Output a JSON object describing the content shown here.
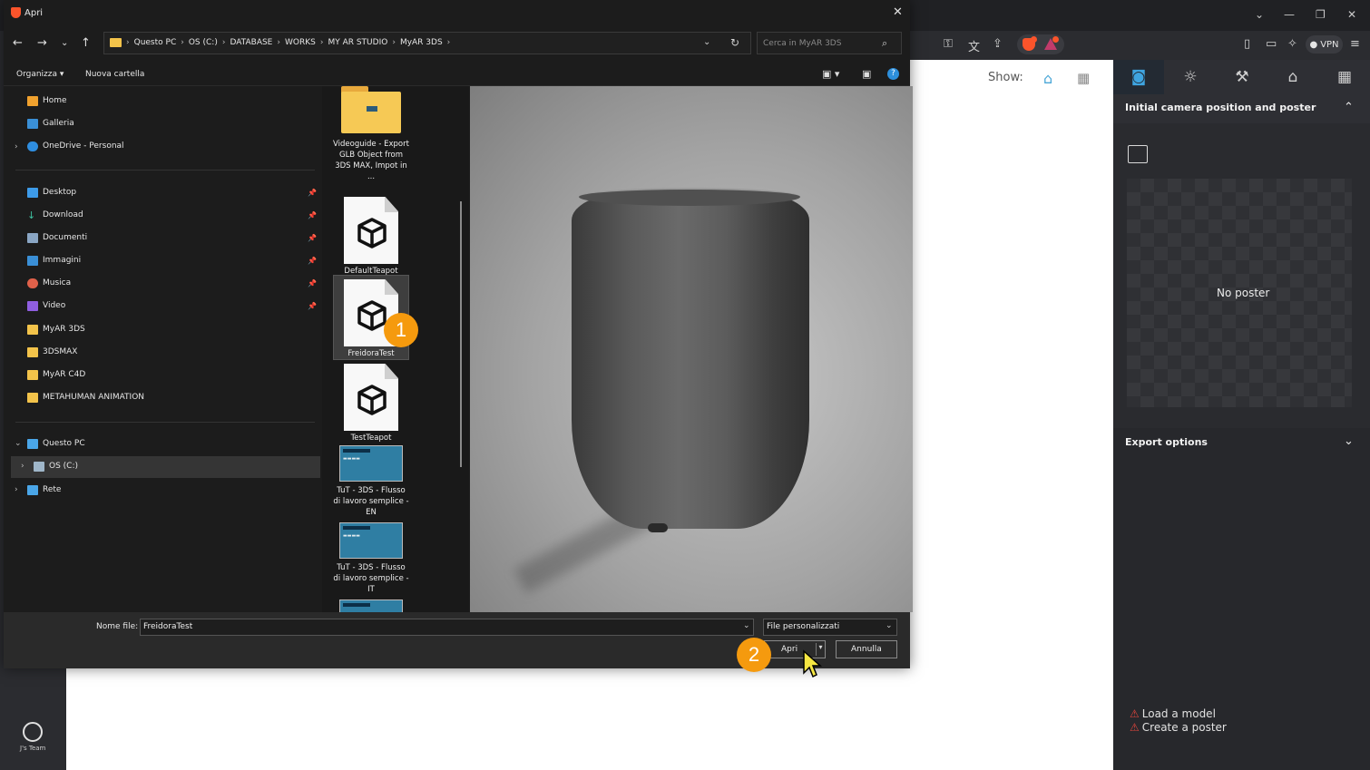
{
  "dialog": {
    "title": "Apri",
    "breadcrumb": [
      "Questo PC",
      "OS (C:)",
      "DATABASE",
      "WORKS",
      "MY AR STUDIO",
      "MyAR 3DS"
    ],
    "search_placeholder": "Cerca in MyAR 3DS",
    "toolbar": {
      "organize": "Organizza",
      "new_folder": "Nuova cartella"
    },
    "nav_quick": [
      "Home",
      "Galleria",
      "OneDrive - Personal"
    ],
    "nav_pinned": [
      "Desktop",
      "Download",
      "Documenti",
      "Immagini",
      "Musica",
      "Video"
    ],
    "nav_folders": [
      "MyAR 3DS",
      "3DSMAX",
      "MyAR C4D",
      "METAHUMAN ANIMATION"
    ],
    "nav_pc": "Questo PC",
    "nav_drive": "OS (C:)",
    "nav_network": "Rete",
    "files": [
      {
        "label": "Videoguide - Export GLB Object from 3DS MAX, Impot in ...",
        "kind": "folder"
      },
      {
        "label": "DefaultTeapot",
        "kind": "model"
      },
      {
        "label": "FreidoraTest",
        "kind": "model",
        "selected": true
      },
      {
        "label": "TestTeapot",
        "kind": "model"
      },
      {
        "label": "TuT - 3DS - Flusso di lavoro semplice - EN",
        "kind": "video"
      },
      {
        "label": "TuT - 3DS - Flusso di lavoro semplice - IT",
        "kind": "video"
      }
    ],
    "file_name_label": "Nome file:",
    "file_name_value": "FreidoraTest",
    "file_type": "File personalizzati",
    "open_button": "Apri",
    "cancel_button": "Annulla"
  },
  "annotations": {
    "step1": "1",
    "step2": "2"
  },
  "app": {
    "show_label": "Show:",
    "section_camera": "Initial camera position and poster",
    "no_poster": "No poster",
    "section_export": "Export options",
    "warnings": [
      "Load a model",
      "Create a poster"
    ],
    "user_label": "J's Team"
  },
  "browser": {
    "vpn_label": "VPN"
  },
  "colors": {
    "accent_badge": "#f59a0e",
    "active_tab": "#3fa4e0",
    "warning": "#e0453c"
  }
}
